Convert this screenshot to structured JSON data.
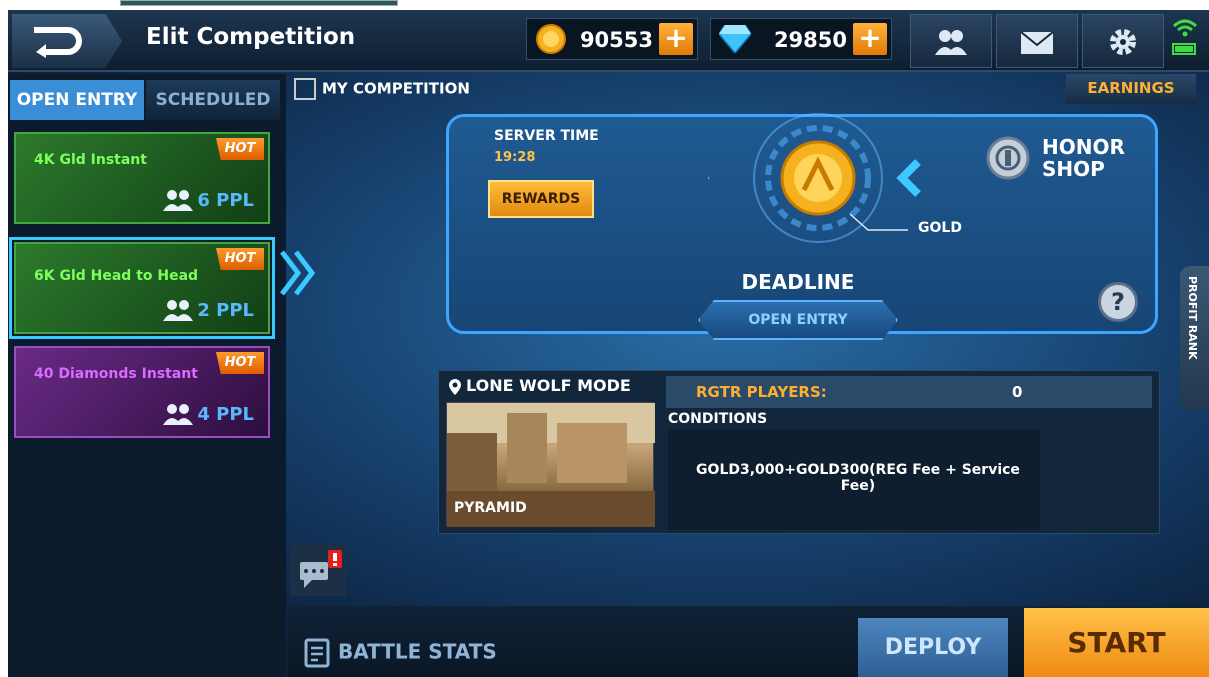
{
  "header": {
    "title": "Elit Competition",
    "gold_amount": "90553",
    "diamond_amount": "29850",
    "plus_label": "+"
  },
  "tabs": {
    "open_entry": "OPEN ENTRY",
    "scheduled": "SCHEDULED"
  },
  "competitions": [
    {
      "name": "4K Gld Instant",
      "badge": "HOT",
      "players": "6 PPL",
      "color": "green"
    },
    {
      "name": "6K Gld Head to Head",
      "badge": "HOT",
      "players": "2 PPL",
      "color": "green",
      "selected": true
    },
    {
      "name": "40 Diamonds Instant",
      "badge": "HOT",
      "players": "4 PPL",
      "color": "purple"
    }
  ],
  "main": {
    "my_competition": "MY COMPETITION",
    "earnings": "EARNINGS",
    "server_time_label": "SERVER TIME",
    "server_time": "19:28",
    "rewards": "REWARDS",
    "gold_label": "GOLD",
    "honor_shop": "HONOR SHOP",
    "deadline": "DEADLINE",
    "open_entry": "OPEN ENTRY",
    "help": "?",
    "profit_rank": "PROFIT RANK"
  },
  "mode": {
    "title": "LONE WOLF MODE",
    "map": "PYRAMID",
    "rgtr_label": "RGTR PLAYERS:",
    "rgtr_value": "0",
    "conditions_label": "CONDITIONS",
    "conditions_text": "GOLD3,000+GOLD300(REG Fee + Service Fee)"
  },
  "bottom": {
    "battle_stats": "BATTLE STATS",
    "deploy": "DEPLOY",
    "start": "START"
  },
  "colors": {
    "accent_blue": "#3fa6ff",
    "gold": "#ffb030",
    "hot_orange": "#f07a10"
  }
}
